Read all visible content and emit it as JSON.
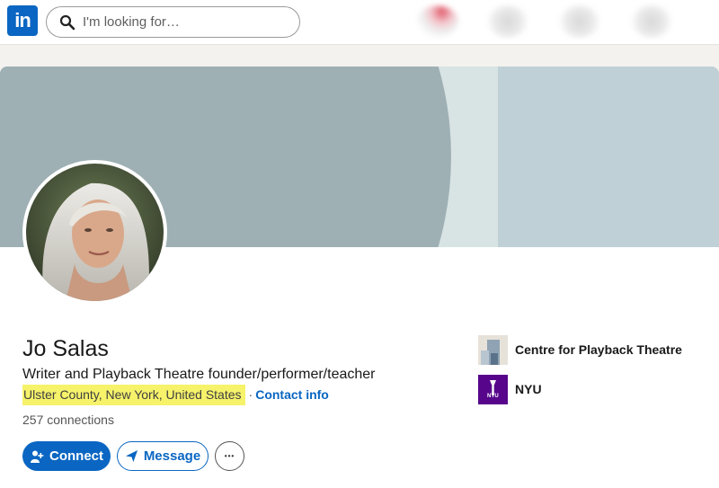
{
  "nav": {
    "logo_text": "in",
    "search_placeholder": "I'm looking for…"
  },
  "profile": {
    "name": "Jo Salas",
    "headline": "Writer and Playback Theatre founder/performer/teacher",
    "location": "Ulster County, New York, United States",
    "separator": "·",
    "contact_info_label": "Contact info",
    "connections": "257 connections"
  },
  "actions": {
    "connect_label": "Connect",
    "message_label": "Message",
    "more_label": "•••"
  },
  "organizations": [
    {
      "name": "Centre for Playback Theatre",
      "icon": "building-icon"
    },
    {
      "name": "NYU",
      "logo_text": "NYU",
      "icon": "nyu-torch-logo"
    }
  ],
  "colors": {
    "brand_blue": "#0a66c2",
    "highlight": "#f6f26a",
    "nyu_purple": "#57068c",
    "banner_dark": "#9eb0b4",
    "banner_light": "#bfd1d6"
  }
}
